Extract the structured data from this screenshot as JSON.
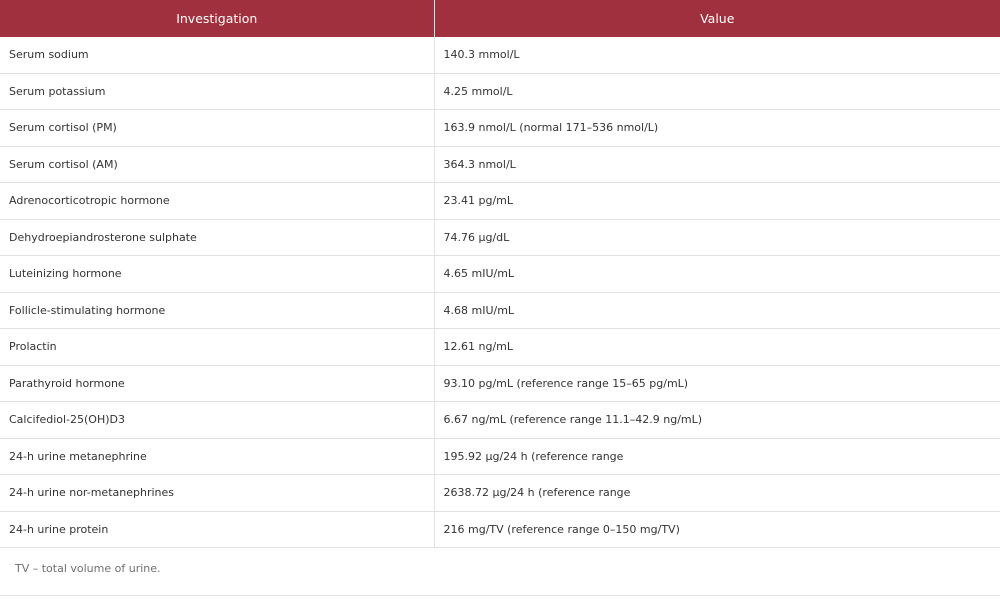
{
  "table": {
    "headers": [
      "Investigation",
      "Value"
    ],
    "rows": [
      [
        "Serum sodium",
        "140.3 mmol/L"
      ],
      [
        "Serum potassium",
        "4.25 mmol/L"
      ],
      [
        "Serum cortisol (PM)",
        "163.9 nmol/L (normal 171–536 nmol/L)"
      ],
      [
        "Serum cortisol (AM)",
        "364.3 nmol/L"
      ],
      [
        "Adrenocorticotropic hormone",
        "23.41 pg/mL"
      ],
      [
        "Dehydroepiandrosterone sulphate",
        "74.76 μg/dL"
      ],
      [
        "Luteinizing hormone",
        "4.65 mIU/mL"
      ],
      [
        "Follicle-stimulating hormone",
        "4.68 mIU/mL"
      ],
      [
        "Prolactin",
        "12.61 ng/mL"
      ],
      [
        "Parathyroid hormone",
        "93.10 pg/mL (reference range 15–65 pg/mL)"
      ],
      [
        "Calcifediol-25(OH)D3",
        "6.67 ng/mL (reference range 11.1–42.9 ng/mL)"
      ],
      [
        "24-h urine metanephrine",
        "195.92 μg/24 h (reference range"
      ],
      [
        "24-h urine nor-metanephrines",
        "2638.72 μg/24 h (reference range"
      ],
      [
        "24-h urine protein",
        "216 mg/TV (reference range 0–150 mg/TV)"
      ]
    ]
  },
  "footnote": "TV – total volume of urine.",
  "colors": {
    "header_bg": "#a0303e",
    "header_text": "#ffffff",
    "body_text": "#333333",
    "footnote_text": "#6f6f6f"
  }
}
